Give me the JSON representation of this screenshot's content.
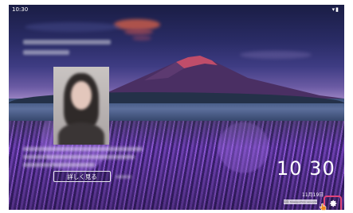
{
  "status_bar": {
    "time": "10:30",
    "icons": "▾▮"
  },
  "lockscreen": {
    "details_button_label": "詳しく見る",
    "clock_time": "10 30",
    "date_text": "11月19日",
    "photo_credit": "写真: Kawaguchiko Lavender"
  },
  "icons": {
    "settings": "gear-icon",
    "pointer": "hand-pointer-icon"
  },
  "colors": {
    "highlight": "#e0457b",
    "text": "#ffffff"
  }
}
